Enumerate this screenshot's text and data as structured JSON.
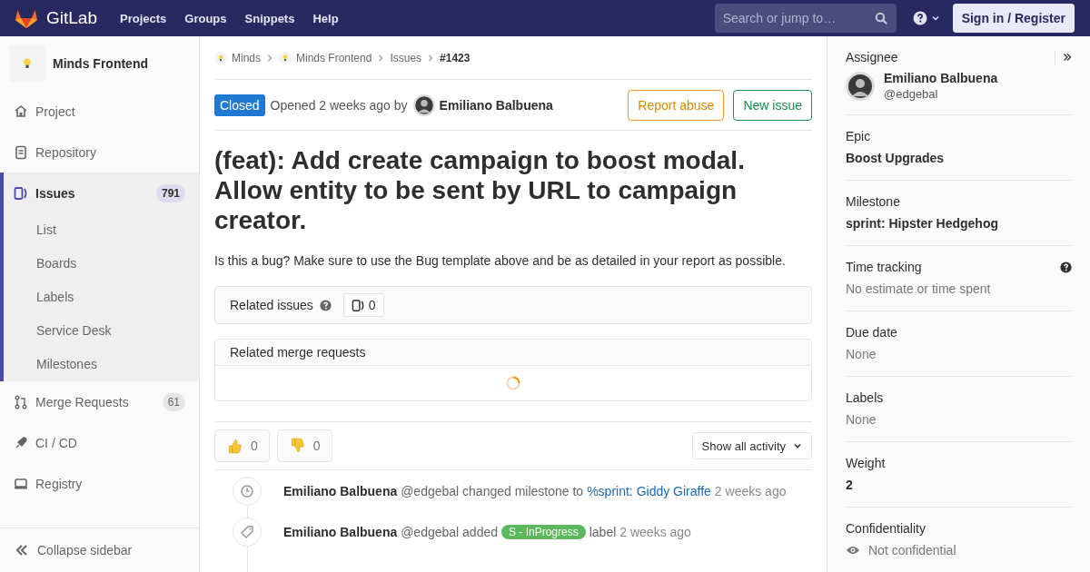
{
  "navbar": {
    "brand": "GitLab",
    "links": [
      "Projects",
      "Groups",
      "Snippets",
      "Help"
    ],
    "search": {
      "placeholder": "Search or jump to…"
    },
    "sign_in": "Sign in / Register"
  },
  "sidebar": {
    "project": "Minds Frontend",
    "items": [
      {
        "label": "Project",
        "selected": false
      },
      {
        "label": "Repository",
        "selected": false
      },
      {
        "label": "Issues",
        "count": "791",
        "selected": true,
        "expanded": true,
        "children": [
          {
            "label": "List",
            "selected": false
          },
          {
            "label": "Boards",
            "selected": false
          },
          {
            "label": "Labels",
            "selected": false
          },
          {
            "label": "Service Desk",
            "selected": false
          },
          {
            "label": "Milestones",
            "selected": false
          }
        ]
      },
      {
        "label": "Merge Requests",
        "count": "61",
        "selected": false
      },
      {
        "label": "CI / CD",
        "selected": false
      },
      {
        "label": "Registry",
        "selected": false
      }
    ],
    "collapse": "Collapse sidebar"
  },
  "breadcrumbs": [
    "Minds",
    "Minds Frontend",
    "Issues",
    "#1423"
  ],
  "issue": {
    "status": "Closed",
    "closed": true,
    "opened": "Opened 2 weeks ago by",
    "author": "Emiliano Balbuena",
    "buttons": [
      {
        "kind": "warning",
        "label": "Report abuse"
      },
      {
        "kind": "success",
        "label": "New issue"
      }
    ],
    "title": "(feat): Add create campaign to boost modal. Allow entity to be sent by URL to campaign creator.",
    "description": "Is this a bug? Make sure to use the Bug template above and be as detailed in your report as possible."
  },
  "related_issues": {
    "label": "Related issues",
    "count": "0"
  },
  "related_merge_requests": {
    "label": "Related merge requests",
    "loading": true
  },
  "reactions": [
    {
      "kind": "thumbsup",
      "count": "0"
    },
    {
      "kind": "thumbsdown",
      "count": "0"
    }
  ],
  "activity_filter": "Show all activity",
  "notes": [
    {
      "kind": "milestone",
      "author": "Emiliano Balbuena",
      "handle": "@edgebal",
      "action": "changed milestone to",
      "link": "%sprint: Giddy Giraffe",
      "time": "2 weeks ago"
    },
    {
      "kind": "label",
      "author": "Emiliano Balbuena",
      "handle": "@edgebal",
      "action": "added",
      "label": {
        "text": "S - InProgress",
        "color": "#5cb85c"
      },
      "suffix": "label",
      "time": "2 weeks ago"
    }
  ],
  "right_sidebar": {
    "assignee": {
      "label": "Assignee",
      "name": "Emiliano Balbuena",
      "handle": "@edgebal"
    },
    "blocks": [
      {
        "kind": "strong",
        "label": "Epic",
        "value": "Boost Upgrades"
      },
      {
        "kind": "strong",
        "label": "Milestone",
        "value": "sprint: Hipster Hedgehog"
      },
      {
        "kind": "tracking",
        "label": "Time tracking",
        "value": "No estimate or time spent"
      },
      {
        "kind": "muted",
        "label": "Due date",
        "value": "None"
      },
      {
        "kind": "muted",
        "label": "Labels",
        "value": "None"
      },
      {
        "kind": "strong",
        "label": "Weight",
        "value": "2"
      },
      {
        "kind": "confidentiality",
        "label": "Confidentiality",
        "value": "Not confidential"
      }
    ]
  }
}
